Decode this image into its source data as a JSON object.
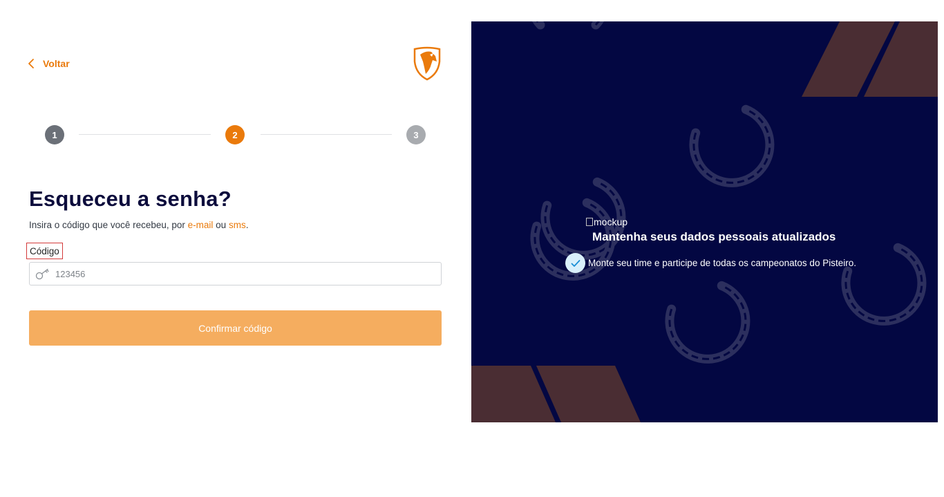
{
  "nav": {
    "back_label": "Voltar"
  },
  "steps": [
    {
      "number": "1",
      "state": "done"
    },
    {
      "number": "2",
      "state": "active"
    },
    {
      "number": "3",
      "state": "pending"
    }
  ],
  "form": {
    "title": "Esqueceu a senha?",
    "subtitle_prefix": "Insira o código que você recebeu, por ",
    "subtitle_email": "e-mail",
    "subtitle_or": " ou ",
    "subtitle_sms": "sms",
    "subtitle_end": ".",
    "code_label": "Código",
    "code_placeholder": "123456",
    "code_value": "",
    "submit_label": "Confirmar código"
  },
  "promo": {
    "mockup_alt": "mockup",
    "title": "Mantenha seus dados pessoais atualizados",
    "feature_text": "Monte seu time e participe de todas os campeonatos do Pisteiro."
  },
  "colors": {
    "accent": "#ea7a0b",
    "button_disabled": "#f5ad5f",
    "promo_background": "#030742",
    "stripe": "#4a2d33",
    "title": "#0c0c3c"
  },
  "icons": {
    "back": "chevron-left-icon",
    "logo": "horse-shield-logo",
    "key": "key-icon",
    "check": "check-icon",
    "decoration": "horseshoe-icon"
  }
}
